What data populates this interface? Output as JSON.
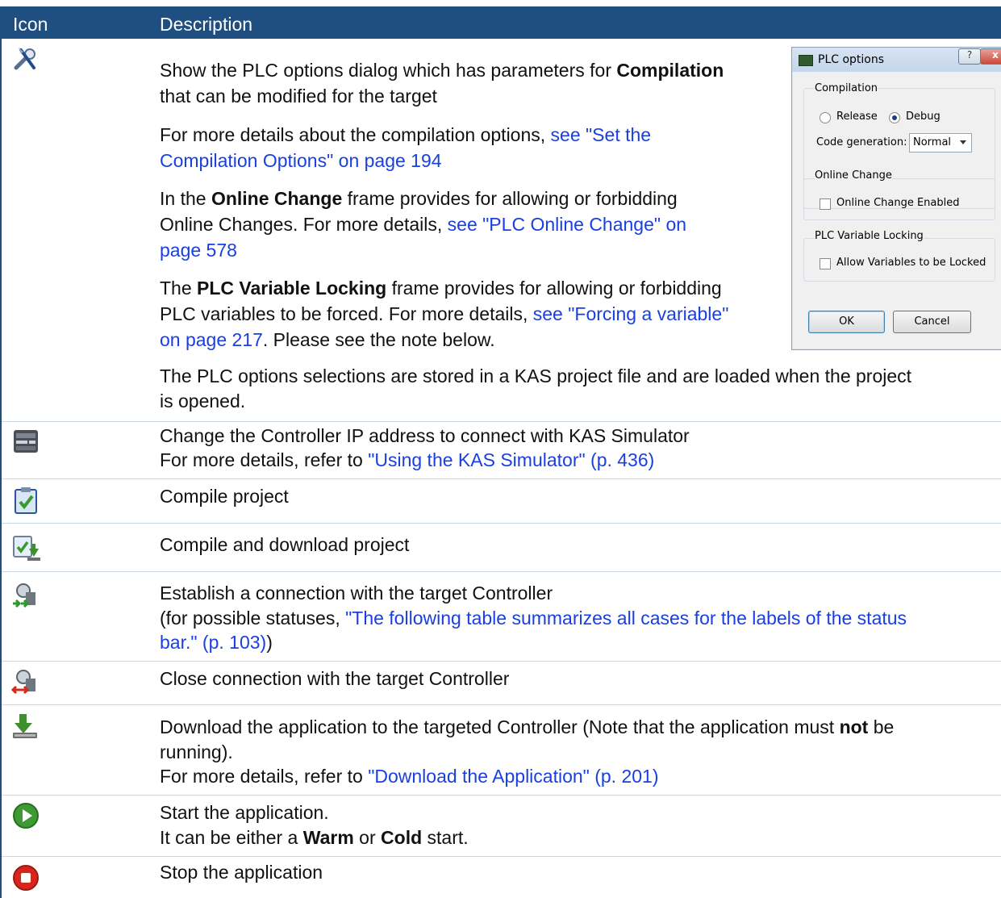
{
  "header": {
    "icon_col": "Icon",
    "description_col": "Description"
  },
  "rows": {
    "plc_options": {
      "icon": "tools-icon",
      "p1_a": "Show the PLC options dialog which has parameters for ",
      "p1_b": "Compilation",
      "p1_c": "that can be modified for the target",
      "p2_a": "For more details about the compilation options, ",
      "p2_link1": "see \"Set the",
      "p2_link2": "Compilation Options\" on page 194",
      "p3_a": "In the ",
      "p3_b": "Online Change",
      "p3_c": " frame provides for allowing or forbidding",
      "p3_d": "Online Changes. For more details, ",
      "p3_link1": "see \"PLC Online Change\" on",
      "p3_link2": "page 578",
      "p4_a": "The ",
      "p4_b": "PLC Variable Locking",
      "p4_c": " frame provides for allowing or forbidding",
      "p4_d": "PLC variables to be forced. For more details, ",
      "p4_link1": "see \"Forcing a variable\"",
      "p4_link2": "on page 217",
      "p4_e": ". Please see the note below.",
      "p5_a": "The PLC options selections are stored in a KAS project file and are loaded when the project",
      "p5_b": "is opened."
    },
    "ip": {
      "icon": "ip-address-icon",
      "line1": "Change the Controller IP address to connect with KAS Simulator",
      "line2_a": "For more details, refer to ",
      "line2_link": "\"Using the KAS Simulator\" (p. 436)"
    },
    "compile": {
      "icon": "compile-icon",
      "text": "Compile project"
    },
    "compile_download": {
      "icon": "compile-download-icon",
      "text": "Compile and download project"
    },
    "connect": {
      "icon": "connect-icon",
      "line1": "Establish a connection with the target Controller",
      "line2_a": "(for possible statuses, ",
      "line2_link": "\"The following table summarizes all cases for the labels of the status",
      "line3_link": "bar.\" (p. 103)",
      "line3_b": ")"
    },
    "disconnect": {
      "icon": "disconnect-icon",
      "text": "Close connection with the target Controller"
    },
    "download": {
      "icon": "download-icon",
      "line1_a": "Download the application to the targeted Controller (Note that the application must ",
      "line1_b": "not",
      "line1_c": " be",
      "line2": "running).",
      "line3_a": "For more details, refer to ",
      "line3_link": "\"Download the Application\" (p. 201)"
    },
    "start": {
      "icon": "play-icon",
      "line1": "Start the application.",
      "line2_a": "It can be either a ",
      "line2_b": "Warm",
      "line2_c": " or ",
      "line2_d": "Cold",
      "line2_e": " start."
    },
    "stop": {
      "icon": "stop-icon",
      "text": "Stop the application"
    }
  },
  "dialog": {
    "title": "PLC options",
    "help_btn": "?",
    "close_btn": "x",
    "compilation": {
      "label": "Compilation",
      "release": "Release",
      "debug": "Debug",
      "selected": "Debug",
      "codegen_label": "Code generation:",
      "codegen_value": "Normal"
    },
    "online_change": {
      "label": "Online Change",
      "checkbox": "Online Change Enabled"
    },
    "locking": {
      "label": "PLC Variable Locking",
      "checkbox": "Allow Variables to be Locked"
    },
    "ok": "OK",
    "cancel": "Cancel"
  },
  "colors": {
    "header_bg": "#1f4e80",
    "link": "#1a3fe0"
  }
}
